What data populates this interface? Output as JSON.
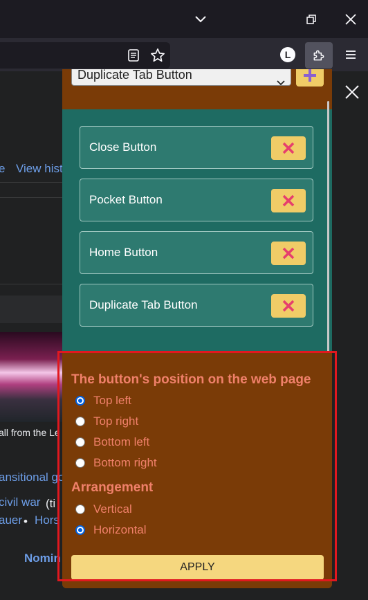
{
  "popup": {
    "selected_option": "Duplicate Tab Button",
    "items": [
      {
        "label": "Close Button"
      },
      {
        "label": "Pocket Button"
      },
      {
        "label": "Home Button"
      },
      {
        "label": "Duplicate Tab Button"
      }
    ],
    "position_section": {
      "title": "The button's position on the web page",
      "options": [
        {
          "label": "Top left",
          "checked": true
        },
        {
          "label": "Top right",
          "checked": false
        },
        {
          "label": "Bottom left",
          "checked": false
        },
        {
          "label": "Bottom right",
          "checked": false
        }
      ]
    },
    "arrangement_section": {
      "title": "Arrangement",
      "options": [
        {
          "label": "Vertical",
          "checked": false
        },
        {
          "label": "Horizontal",
          "checked": true
        }
      ]
    },
    "apply_label": "APPLY"
  },
  "toolbar": {
    "avatar_letter": "L"
  },
  "page": {
    "link_e": "e",
    "link_view_history": "View hist",
    "caption": "all from the Le",
    "link_transitional": "ansitional go",
    "link_civil_war": "civil war",
    "text_paren": "(ti",
    "link_auer": "auer",
    "text_bullet": " • ",
    "link_horst": "Hors",
    "heading_nomin": "Nomin"
  },
  "colors": {
    "popup_green": "#1e6b62",
    "popup_brown": "#7a3b07",
    "button_yellow": "#f0cc67",
    "label_salmon": "#f0806a",
    "highlight_red": "#e1181f"
  }
}
